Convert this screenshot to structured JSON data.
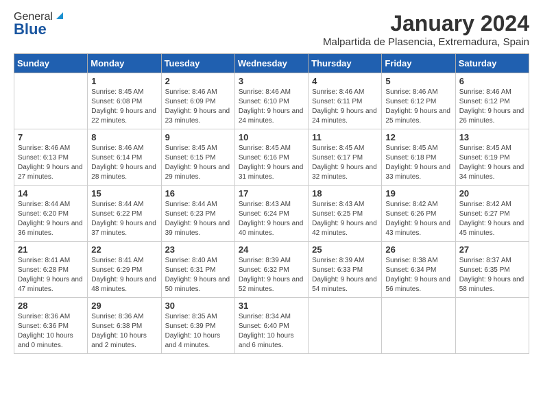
{
  "logo": {
    "general": "General",
    "blue": "Blue"
  },
  "title": "January 2024",
  "subtitle": "Malpartida de Plasencia, Extremadura, Spain",
  "days_of_week": [
    "Sunday",
    "Monday",
    "Tuesday",
    "Wednesday",
    "Thursday",
    "Friday",
    "Saturday"
  ],
  "weeks": [
    [
      {
        "day": null,
        "info": null
      },
      {
        "day": "1",
        "sunrise": "Sunrise: 8:45 AM",
        "sunset": "Sunset: 6:08 PM",
        "daylight": "Daylight: 9 hours and 22 minutes."
      },
      {
        "day": "2",
        "sunrise": "Sunrise: 8:46 AM",
        "sunset": "Sunset: 6:09 PM",
        "daylight": "Daylight: 9 hours and 23 minutes."
      },
      {
        "day": "3",
        "sunrise": "Sunrise: 8:46 AM",
        "sunset": "Sunset: 6:10 PM",
        "daylight": "Daylight: 9 hours and 24 minutes."
      },
      {
        "day": "4",
        "sunrise": "Sunrise: 8:46 AM",
        "sunset": "Sunset: 6:11 PM",
        "daylight": "Daylight: 9 hours and 24 minutes."
      },
      {
        "day": "5",
        "sunrise": "Sunrise: 8:46 AM",
        "sunset": "Sunset: 6:12 PM",
        "daylight": "Daylight: 9 hours and 25 minutes."
      },
      {
        "day": "6",
        "sunrise": "Sunrise: 8:46 AM",
        "sunset": "Sunset: 6:12 PM",
        "daylight": "Daylight: 9 hours and 26 minutes."
      }
    ],
    [
      {
        "day": "7",
        "sunrise": "Sunrise: 8:46 AM",
        "sunset": "Sunset: 6:13 PM",
        "daylight": "Daylight: 9 hours and 27 minutes."
      },
      {
        "day": "8",
        "sunrise": "Sunrise: 8:46 AM",
        "sunset": "Sunset: 6:14 PM",
        "daylight": "Daylight: 9 hours and 28 minutes."
      },
      {
        "day": "9",
        "sunrise": "Sunrise: 8:45 AM",
        "sunset": "Sunset: 6:15 PM",
        "daylight": "Daylight: 9 hours and 29 minutes."
      },
      {
        "day": "10",
        "sunrise": "Sunrise: 8:45 AM",
        "sunset": "Sunset: 6:16 PM",
        "daylight": "Daylight: 9 hours and 31 minutes."
      },
      {
        "day": "11",
        "sunrise": "Sunrise: 8:45 AM",
        "sunset": "Sunset: 6:17 PM",
        "daylight": "Daylight: 9 hours and 32 minutes."
      },
      {
        "day": "12",
        "sunrise": "Sunrise: 8:45 AM",
        "sunset": "Sunset: 6:18 PM",
        "daylight": "Daylight: 9 hours and 33 minutes."
      },
      {
        "day": "13",
        "sunrise": "Sunrise: 8:45 AM",
        "sunset": "Sunset: 6:19 PM",
        "daylight": "Daylight: 9 hours and 34 minutes."
      }
    ],
    [
      {
        "day": "14",
        "sunrise": "Sunrise: 8:44 AM",
        "sunset": "Sunset: 6:20 PM",
        "daylight": "Daylight: 9 hours and 36 minutes."
      },
      {
        "day": "15",
        "sunrise": "Sunrise: 8:44 AM",
        "sunset": "Sunset: 6:22 PM",
        "daylight": "Daylight: 9 hours and 37 minutes."
      },
      {
        "day": "16",
        "sunrise": "Sunrise: 8:44 AM",
        "sunset": "Sunset: 6:23 PM",
        "daylight": "Daylight: 9 hours and 39 minutes."
      },
      {
        "day": "17",
        "sunrise": "Sunrise: 8:43 AM",
        "sunset": "Sunset: 6:24 PM",
        "daylight": "Daylight: 9 hours and 40 minutes."
      },
      {
        "day": "18",
        "sunrise": "Sunrise: 8:43 AM",
        "sunset": "Sunset: 6:25 PM",
        "daylight": "Daylight: 9 hours and 42 minutes."
      },
      {
        "day": "19",
        "sunrise": "Sunrise: 8:42 AM",
        "sunset": "Sunset: 6:26 PM",
        "daylight": "Daylight: 9 hours and 43 minutes."
      },
      {
        "day": "20",
        "sunrise": "Sunrise: 8:42 AM",
        "sunset": "Sunset: 6:27 PM",
        "daylight": "Daylight: 9 hours and 45 minutes."
      }
    ],
    [
      {
        "day": "21",
        "sunrise": "Sunrise: 8:41 AM",
        "sunset": "Sunset: 6:28 PM",
        "daylight": "Daylight: 9 hours and 47 minutes."
      },
      {
        "day": "22",
        "sunrise": "Sunrise: 8:41 AM",
        "sunset": "Sunset: 6:29 PM",
        "daylight": "Daylight: 9 hours and 48 minutes."
      },
      {
        "day": "23",
        "sunrise": "Sunrise: 8:40 AM",
        "sunset": "Sunset: 6:31 PM",
        "daylight": "Daylight: 9 hours and 50 minutes."
      },
      {
        "day": "24",
        "sunrise": "Sunrise: 8:39 AM",
        "sunset": "Sunset: 6:32 PM",
        "daylight": "Daylight: 9 hours and 52 minutes."
      },
      {
        "day": "25",
        "sunrise": "Sunrise: 8:39 AM",
        "sunset": "Sunset: 6:33 PM",
        "daylight": "Daylight: 9 hours and 54 minutes."
      },
      {
        "day": "26",
        "sunrise": "Sunrise: 8:38 AM",
        "sunset": "Sunset: 6:34 PM",
        "daylight": "Daylight: 9 hours and 56 minutes."
      },
      {
        "day": "27",
        "sunrise": "Sunrise: 8:37 AM",
        "sunset": "Sunset: 6:35 PM",
        "daylight": "Daylight: 9 hours and 58 minutes."
      }
    ],
    [
      {
        "day": "28",
        "sunrise": "Sunrise: 8:36 AM",
        "sunset": "Sunset: 6:36 PM",
        "daylight": "Daylight: 10 hours and 0 minutes."
      },
      {
        "day": "29",
        "sunrise": "Sunrise: 8:36 AM",
        "sunset": "Sunset: 6:38 PM",
        "daylight": "Daylight: 10 hours and 2 minutes."
      },
      {
        "day": "30",
        "sunrise": "Sunrise: 8:35 AM",
        "sunset": "Sunset: 6:39 PM",
        "daylight": "Daylight: 10 hours and 4 minutes."
      },
      {
        "day": "31",
        "sunrise": "Sunrise: 8:34 AM",
        "sunset": "Sunset: 6:40 PM",
        "daylight": "Daylight: 10 hours and 6 minutes."
      },
      {
        "day": null,
        "info": null
      },
      {
        "day": null,
        "info": null
      },
      {
        "day": null,
        "info": null
      }
    ]
  ]
}
